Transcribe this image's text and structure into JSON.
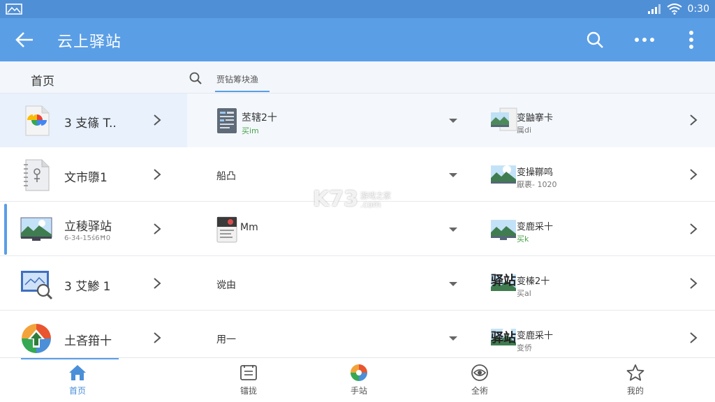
{
  "status": {
    "time": "0:30",
    "left_icon": "gallery-icon",
    "signal_icon": "signal-icon",
    "wifi_icon": "wifi-icon"
  },
  "appbar": {
    "title": "云上驿站",
    "back_icon": "back-arrow-icon",
    "search_icon": "search-icon",
    "more_icon": "more-horizontal-icon",
    "overflow_icon": "overflow-vertical-icon"
  },
  "subbar": {
    "home_label": "首页",
    "search_hint": "贾钻筹块渔"
  },
  "rows": [
    {
      "name": "3 支篠 T..",
      "sub": "",
      "mid_title": "苤辖2十",
      "mid_sub": "买im",
      "right_title": "变鼬搴卡",
      "right_sub": "属di"
    },
    {
      "name": "文市隳1",
      "sub": "",
      "mid_title": "船凸",
      "mid_sub": "",
      "right_title": "变操鞹鸣",
      "right_sub": "厭裹- 1020"
    },
    {
      "name": "立稜驿站",
      "sub": "6-34-15ś6Ħ0",
      "mid_title": "Mm",
      "mid_sub": "",
      "right_title": "变鹿采十",
      "right_sub": "买k"
    },
    {
      "name": "3 艾鯵 1",
      "sub": "",
      "mid_title": "谠由",
      "mid_sub": "",
      "right_title": "变榛2十",
      "right_sub": "买al",
      "overlay": "驿站"
    },
    {
      "name": "土吝箝十",
      "sub": "",
      "mid_title": "用一",
      "mid_sub": "",
      "right_title": "变鹿采十",
      "right_sub": "变侨",
      "overlay": "驿站"
    }
  ],
  "watermark": {
    "logo": "K73",
    "sub": "游戏之家",
    "url": ".com"
  },
  "tabs": [
    {
      "label": "首页",
      "icon": "home-icon"
    },
    {
      "label": "镭拢",
      "icon": "list-icon"
    },
    {
      "label": "手站",
      "icon": "pie-chart-icon"
    },
    {
      "label": "全術",
      "icon": "eye-icon"
    },
    {
      "label": "我的",
      "icon": "star-icon"
    }
  ],
  "colors": {
    "appbar": "#5a9ee6",
    "statusbar": "#4f8fd6",
    "accent": "#5a9ee6",
    "selected_row": "#e8f1fc"
  }
}
